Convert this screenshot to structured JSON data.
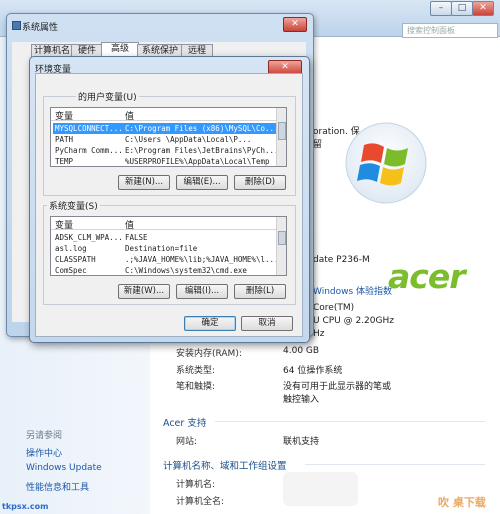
{
  "control_panel": {
    "search_placeholder": "搜索控制面板",
    "see_also": "另请参阅",
    "side_links": [
      "操作中心",
      "Windows Update",
      "性能信息和工具"
    ],
    "fragments": {
      "copyright_tail": "oration. 保",
      "copyright_tail2": "留",
      "model": "date P236-M",
      "experience_index": "Windows 体验指数",
      "cpu1": "Core(TM)",
      "cpu2": "U CPU @ 2.20GHz",
      "cpu3": "Hz"
    },
    "rows": [
      {
        "label": "安装内存(RAM):",
        "value": "4.00 GB"
      },
      {
        "label": "系统类型:",
        "value": "64 位操作系统"
      },
      {
        "label": "笔和触摸:",
        "value": "没有可用于此显示器的笔或"
      },
      {
        "label": "",
        "value": "触控输入"
      }
    ],
    "acer_support": "Acer 支持",
    "website_label": "网站:",
    "website_value": "联机支持",
    "computer_section": "计算机名称、域和工作组设置",
    "computer_name_label": "计算机名:",
    "full_computer_name_label": "计算机全名:",
    "brand": "acer",
    "watermark_left": "tkpsx.com",
    "watermark_right": "吹 桌下载"
  },
  "system_properties": {
    "title": "系统属性",
    "tabs": [
      "计算机名",
      "硬件",
      "高级",
      "系统保护",
      "远程"
    ],
    "selected_tab": "高级"
  },
  "env_dialog": {
    "title": "环境变量",
    "user_group_label": "的用户变量(U)",
    "col_var": "变量",
    "col_val": "值",
    "user_vars": [
      {
        "name": "MYSQLCONNECT...",
        "value": "C:\\Program Files (x86)\\MySQL\\Co...",
        "selected": true
      },
      {
        "name": "PATH",
        "value": "C:\\Users          \\AppData\\Local\\P..."
      },
      {
        "name": "PyCharm Comm...",
        "value": "E:\\Program Files\\JetBrains\\PyCh..."
      },
      {
        "name": "TEMP",
        "value": "%USERPROFILE%\\AppData\\Local\\Temp"
      }
    ],
    "system_group_label": "系统变量(S)",
    "system_vars": [
      {
        "name": "ADSK_CLM_WPA...",
        "value": "FALSE"
      },
      {
        "name": "asl.log",
        "value": "Destination=file"
      },
      {
        "name": "CLASSPATH",
        "value": ".;%JAVA_HOME%\\lib;%JAVA_HOME%\\l..."
      },
      {
        "name": "ComSpec",
        "value": "C:\\Windows\\system32\\cmd.exe"
      }
    ],
    "user_buttons": {
      "new": "新建(N)...",
      "edit": "编辑(E)...",
      "delete": "删除(D)"
    },
    "system_buttons": {
      "new": "新建(W)...",
      "edit": "编辑(I)...",
      "delete": "删除(L)"
    },
    "ok": "确定",
    "cancel": "取消"
  },
  "colors": {
    "accent": "#3399ff",
    "link": "#1c57a8",
    "brand": "#7bbd2c"
  }
}
